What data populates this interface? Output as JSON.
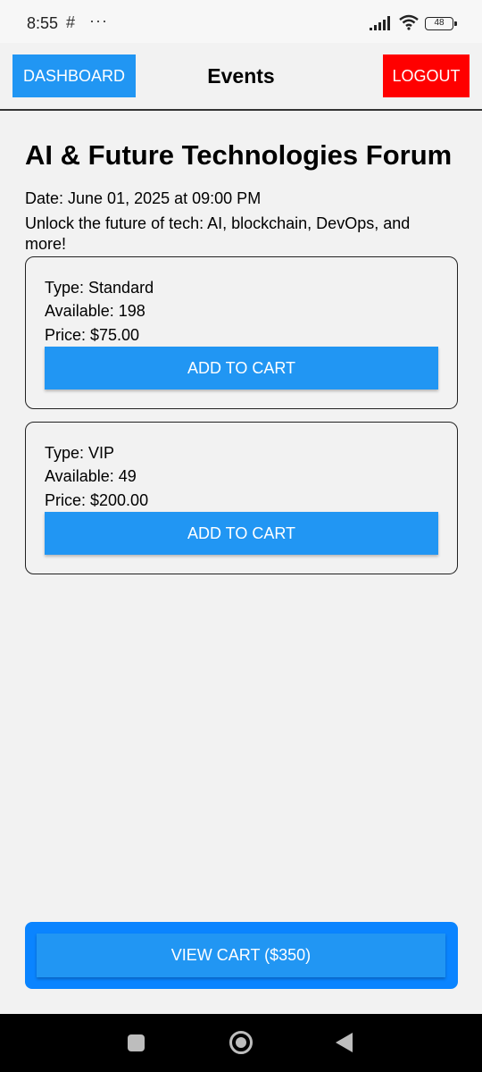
{
  "status_bar": {
    "time": "8:55",
    "slack_glyph": "#",
    "dots": "···",
    "battery": "48",
    "icons": [
      "slack-icon",
      "more-dots-icon",
      "signal-icon",
      "wifi-icon",
      "battery-icon"
    ]
  },
  "header": {
    "dashboard_label": "DASHBOARD",
    "title": "Events",
    "logout_label": "LOGOUT"
  },
  "event": {
    "title": "AI & Future Technologies Forum",
    "date": "Date: June 01, 2025 at 09:00 PM",
    "description": "Unlock the future of tech: AI, blockchain, DevOps, and more!"
  },
  "tickets": [
    {
      "type": "Type: Standard",
      "available": "Available: 198",
      "price": "Price: $75.00",
      "button": "ADD TO CART"
    },
    {
      "type": "Type: VIP",
      "available": "Available: 49",
      "price": "Price: $200.00",
      "button": "ADD TO CART"
    }
  ],
  "cart": {
    "label": "VIEW CART ($350)"
  },
  "nav": {
    "icons": [
      "recents-icon",
      "home-icon",
      "back-icon"
    ]
  },
  "colors": {
    "primary": "#2196f3",
    "danger": "#ff0000",
    "cart_outer": "#0a84ff",
    "background": "#f2f2f2"
  }
}
